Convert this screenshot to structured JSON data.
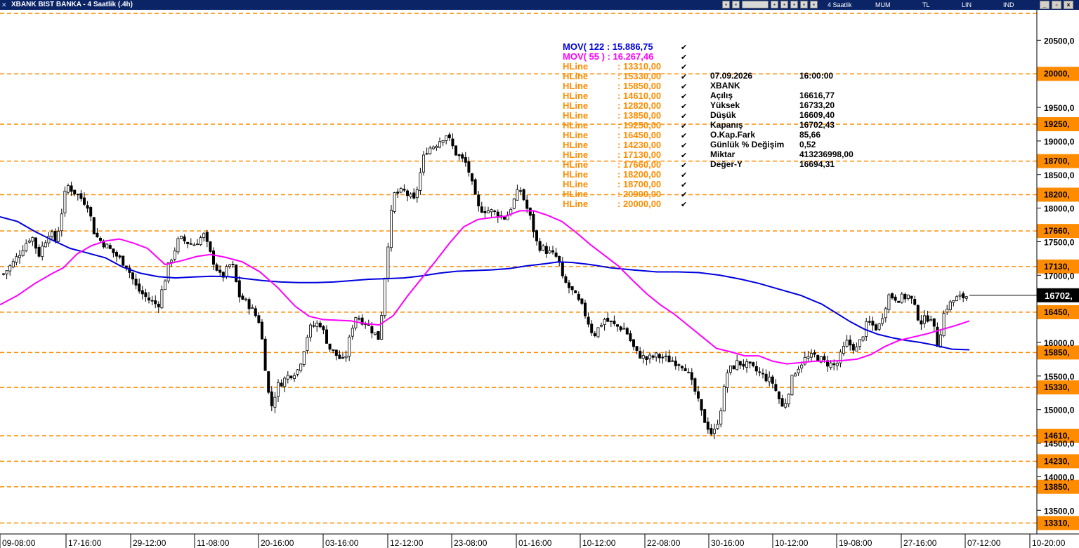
{
  "window": {
    "title": "XBANK BIST BANKA - 4 Saatlik (.4h)",
    "toolbar_labels": [
      "4 Saatlik",
      "MUM",
      "TL",
      "LIN",
      "IND"
    ],
    "controls": [
      "_",
      "▫",
      "×"
    ]
  },
  "chart_data": {
    "type": "candlestick",
    "y_axis": {
      "ticks": [
        {
          "value": 20500,
          "label": "20500,0"
        },
        {
          "value": 19500,
          "label": "19500,0"
        },
        {
          "value": 19000,
          "label": "19000,0"
        },
        {
          "value": 18500,
          "label": "18500,0"
        },
        {
          "value": 18000,
          "label": "18000,0"
        },
        {
          "value": 17500,
          "label": "17500,0"
        },
        {
          "value": 17000,
          "label": "17000,0"
        },
        {
          "value": 16000,
          "label": "16000,0"
        },
        {
          "value": 15500,
          "label": "15500,0"
        },
        {
          "value": 15000,
          "label": "15000,0"
        },
        {
          "value": 14500,
          "label": "14500,0"
        },
        {
          "value": 14000,
          "label": "14000,0"
        },
        {
          "value": 13500,
          "label": "13500,0"
        }
      ]
    },
    "x_axis": {
      "ticks": [
        "09-08:00",
        "17-16:00",
        "29-12:00",
        "11-08:00",
        "20-16:00",
        "03-16:00",
        "12-12:00",
        "23-08:00",
        "01-16:00",
        "10-12:00",
        "22-08:00",
        "30-16:00",
        "10-12:00",
        "19-08:00",
        "27-16:00",
        "07-12:00",
        "10-20:00"
      ]
    },
    "last_price_label": "16702,",
    "hlines": [
      {
        "value": 13310,
        "label": "13310,00",
        "axis_label": "13310,"
      },
      {
        "value": 15330,
        "label": "15330,00",
        "axis_label": "15330,"
      },
      {
        "value": 15850,
        "label": "15850,00",
        "axis_label": "15850,"
      },
      {
        "value": 14610,
        "label": "14610,00",
        "axis_label": "14610,"
      },
      {
        "value": 12820,
        "label": "12820,00",
        "axis_label": ""
      },
      {
        "value": 13850,
        "label": "13850,00",
        "axis_label": "13850,"
      },
      {
        "value": 19250,
        "label": "19250,00",
        "axis_label": "19250,"
      },
      {
        "value": 16450,
        "label": "16450,00",
        "axis_label": "16450,"
      },
      {
        "value": 14230,
        "label": "14230,00",
        "axis_label": "14230,"
      },
      {
        "value": 17130,
        "label": "17130,00",
        "axis_label": "17130,"
      },
      {
        "value": 17660,
        "label": "17660,00",
        "axis_label": "17660,"
      },
      {
        "value": 18200,
        "label": "18200,00",
        "axis_label": "18200,"
      },
      {
        "value": 18700,
        "label": "18700,00",
        "axis_label": "18700,"
      },
      {
        "value": 20900,
        "label": "20900,00",
        "axis_label": ""
      },
      {
        "value": 20000,
        "label": "20000,00",
        "axis_label": "20000,"
      }
    ],
    "hline_name": "HLine",
    "moving_averages": [
      {
        "label": "MOV( 122 : 15.886,75",
        "color": "#0000dd"
      },
      {
        "label": "MOV( 55 ) : 16.267,46",
        "color": "#ff00ff"
      }
    ],
    "ma_key_series": [
      {
        "period": 122,
        "color": "#0000dd",
        "points": [
          [
            0,
            17870
          ],
          [
            25,
            17800
          ],
          [
            50,
            17650
          ],
          [
            75,
            17520
          ],
          [
            100,
            17400
          ],
          [
            125,
            17330
          ],
          [
            150,
            17260
          ],
          [
            175,
            17120
          ],
          [
            200,
            17030
          ],
          [
            225,
            16980
          ],
          [
            250,
            16960
          ],
          [
            275,
            16975
          ],
          [
            300,
            16985
          ],
          [
            325,
            16980
          ],
          [
            350,
            16950
          ],
          [
            375,
            16920
          ],
          [
            400,
            16900
          ],
          [
            425,
            16890
          ],
          [
            450,
            16890
          ],
          [
            475,
            16900
          ],
          [
            500,
            16920
          ],
          [
            525,
            16940
          ],
          [
            550,
            16950
          ],
          [
            575,
            16960
          ],
          [
            600,
            16990
          ],
          [
            625,
            17030
          ],
          [
            650,
            17060
          ],
          [
            675,
            17070
          ],
          [
            700,
            17080
          ],
          [
            725,
            17100
          ],
          [
            750,
            17140
          ],
          [
            775,
            17170
          ],
          [
            795,
            17200
          ],
          [
            815,
            17190
          ],
          [
            840,
            17160
          ],
          [
            870,
            17110
          ],
          [
            900,
            17080
          ],
          [
            935,
            17050
          ],
          [
            965,
            17050
          ],
          [
            995,
            17040
          ],
          [
            1025,
            17000
          ],
          [
            1055,
            16940
          ],
          [
            1080,
            16880
          ],
          [
            1110,
            16790
          ],
          [
            1140,
            16700
          ],
          [
            1170,
            16570
          ],
          [
            1190,
            16440
          ],
          [
            1210,
            16310
          ],
          [
            1230,
            16200
          ],
          [
            1250,
            16120
          ],
          [
            1270,
            16070
          ],
          [
            1290,
            16030
          ],
          [
            1310,
            16000
          ],
          [
            1330,
            15960
          ],
          [
            1355,
            15900
          ],
          [
            1380,
            15890
          ]
        ]
      },
      {
        "period": 55,
        "color": "#ff00ff",
        "points": [
          [
            0,
            16560
          ],
          [
            25,
            16700
          ],
          [
            50,
            16880
          ],
          [
            75,
            17030
          ],
          [
            90,
            17110
          ],
          [
            110,
            17320
          ],
          [
            130,
            17440
          ],
          [
            150,
            17510
          ],
          [
            170,
            17540
          ],
          [
            190,
            17480
          ],
          [
            210,
            17400
          ],
          [
            235,
            17160
          ],
          [
            260,
            17220
          ],
          [
            280,
            17280
          ],
          [
            300,
            17310
          ],
          [
            320,
            17270
          ],
          [
            345,
            17200
          ],
          [
            370,
            17050
          ],
          [
            395,
            16820
          ],
          [
            420,
            16540
          ],
          [
            440,
            16390
          ],
          [
            460,
            16340
          ],
          [
            480,
            16330
          ],
          [
            500,
            16320
          ],
          [
            520,
            16280
          ],
          [
            540,
            16260
          ],
          [
            560,
            16400
          ],
          [
            580,
            16690
          ],
          [
            600,
            16950
          ],
          [
            620,
            17210
          ],
          [
            640,
            17480
          ],
          [
            660,
            17720
          ],
          [
            680,
            17830
          ],
          [
            700,
            17860
          ],
          [
            720,
            17880
          ],
          [
            740,
            17960
          ],
          [
            760,
            17960
          ],
          [
            780,
            17890
          ],
          [
            800,
            17800
          ],
          [
            820,
            17640
          ],
          [
            840,
            17460
          ],
          [
            860,
            17300
          ],
          [
            880,
            17140
          ],
          [
            900,
            16930
          ],
          [
            920,
            16730
          ],
          [
            940,
            16560
          ],
          [
            960,
            16420
          ],
          [
            980,
            16250
          ],
          [
            1000,
            16080
          ],
          [
            1020,
            15910
          ],
          [
            1040,
            15860
          ],
          [
            1060,
            15800
          ],
          [
            1080,
            15800
          ],
          [
            1100,
            15720
          ],
          [
            1120,
            15680
          ],
          [
            1140,
            15700
          ],
          [
            1160,
            15720
          ],
          [
            1180,
            15720
          ],
          [
            1200,
            15730
          ],
          [
            1220,
            15750
          ],
          [
            1240,
            15820
          ],
          [
            1260,
            15940
          ],
          [
            1280,
            16030
          ],
          [
            1300,
            16080
          ],
          [
            1320,
            16130
          ],
          [
            1340,
            16190
          ],
          [
            1360,
            16250
          ],
          [
            1380,
            16320
          ]
        ]
      }
    ],
    "ohlc_info": {
      "date": "07.09.2026",
      "time": "16:00:00",
      "symbol": "XBANK",
      "rows": [
        {
          "label": "Açılış",
          "value": "16616,77"
        },
        {
          "label": "Yüksek",
          "value": "16733,20"
        },
        {
          "label": "Düşük",
          "value": "16609,40"
        },
        {
          "label": "Kapanış",
          "value": "16702,43"
        },
        {
          "label": "O.Kap.Fark",
          "value": "85,66"
        },
        {
          "label": "Günlük % Değişim",
          "value": "0,52"
        },
        {
          "label": "Miktar",
          "value": "413236998,00"
        },
        {
          "label": "Değer-Y",
          "value": "16694,31"
        }
      ]
    },
    "price_path": [
      [
        5,
        17020
      ],
      [
        20,
        17200
      ],
      [
        35,
        17450
      ],
      [
        45,
        17600
      ],
      [
        55,
        17300
      ],
      [
        70,
        17650
      ],
      [
        80,
        17500
      ],
      [
        95,
        18350
      ],
      [
        110,
        18200
      ],
      [
        125,
        18050
      ],
      [
        135,
        17600
      ],
      [
        150,
        17450
      ],
      [
        165,
        17300
      ],
      [
        180,
        17150
      ],
      [
        195,
        16800
      ],
      [
        210,
        16650
      ],
      [
        225,
        16550
      ],
      [
        240,
        17150
      ],
      [
        255,
        17550
      ],
      [
        275,
        17450
      ],
      [
        290,
        17600
      ],
      [
        300,
        17300
      ],
      [
        315,
        16950
      ],
      [
        330,
        17200
      ],
      [
        340,
        16700
      ],
      [
        355,
        16550
      ],
      [
        370,
        16300
      ],
      [
        385,
        15000
      ],
      [
        395,
        15350
      ],
      [
        410,
        15500
      ],
      [
        425,
        15600
      ],
      [
        440,
        16200
      ],
      [
        455,
        16300
      ],
      [
        470,
        15900
      ],
      [
        490,
        15700
      ],
      [
        505,
        16400
      ],
      [
        520,
        16300
      ],
      [
        540,
        16050
      ],
      [
        550,
        17250
      ],
      [
        560,
        18200
      ],
      [
        575,
        18250
      ],
      [
        590,
        18100
      ],
      [
        605,
        18850
      ],
      [
        620,
        18950
      ],
      [
        635,
        19100
      ],
      [
        650,
        18800
      ],
      [
        665,
        18650
      ],
      [
        680,
        18000
      ],
      [
        700,
        17950
      ],
      [
        720,
        17850
      ],
      [
        740,
        18300
      ],
      [
        755,
        17850
      ],
      [
        765,
        17450
      ],
      [
        780,
        17350
      ],
      [
        795,
        17250
      ],
      [
        800,
        16950
      ],
      [
        815,
        16750
      ],
      [
        830,
        16500
      ],
      [
        845,
        16100
      ],
      [
        860,
        16350
      ],
      [
        875,
        16250
      ],
      [
        890,
        16200
      ],
      [
        905,
        15850
      ],
      [
        920,
        15750
      ],
      [
        935,
        15800
      ],
      [
        950,
        15750
      ],
      [
        965,
        15700
      ],
      [
        975,
        15650
      ],
      [
        990,
        15250
      ],
      [
        1000,
        14900
      ],
      [
        1015,
        14600
      ],
      [
        1025,
        14950
      ],
      [
        1035,
        15550
      ],
      [
        1050,
        15700
      ],
      [
        1065,
        15650
      ],
      [
        1080,
        15550
      ],
      [
        1100,
        15400
      ],
      [
        1115,
        15000
      ],
      [
        1130,
        15550
      ],
      [
        1145,
        15750
      ],
      [
        1160,
        15800
      ],
      [
        1175,
        15700
      ],
      [
        1190,
        15650
      ],
      [
        1205,
        16000
      ],
      [
        1220,
        15900
      ],
      [
        1235,
        16300
      ],
      [
        1250,
        16200
      ],
      [
        1265,
        16700
      ],
      [
        1280,
        16650
      ],
      [
        1295,
        16700
      ],
      [
        1310,
        16300
      ],
      [
        1325,
        16400
      ],
      [
        1335,
        15950
      ],
      [
        1345,
        16500
      ],
      [
        1360,
        16650
      ],
      [
        1380,
        16702
      ]
    ]
  }
}
